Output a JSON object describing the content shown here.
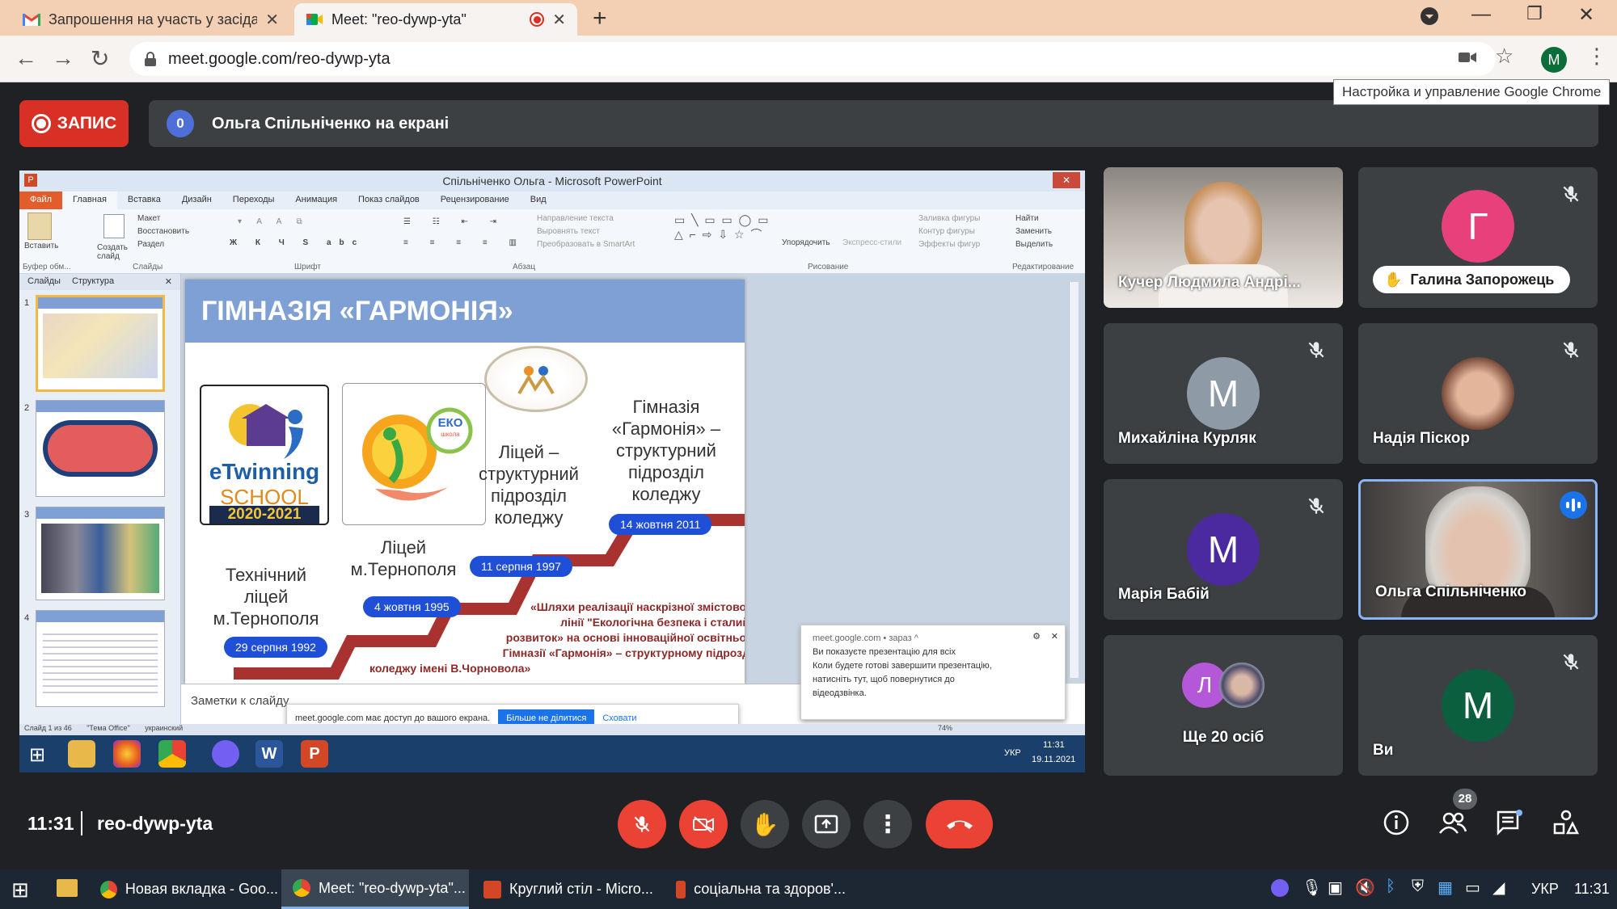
{
  "browser": {
    "tabs": [
      {
        "title": "Запрошення на участь у засіда",
        "icon": "gmail-icon",
        "active": false
      },
      {
        "title": "Meet: \"reo-dywp-yta\"",
        "icon": "meet-icon",
        "active": true
      }
    ],
    "new_tab": "+",
    "url": "meet.google.com/reo-dywp-yta",
    "profile_letter": "M",
    "tooltip": "Настройка и управление Google Chrome"
  },
  "meet": {
    "record_label": "ЗАПИС",
    "presenting_count": "0",
    "presenting_text": "Ольга Спільніченко на екрані",
    "participants": [
      {
        "name": "Кучер Людмила Андрі...",
        "avatar": "",
        "muted": false
      },
      {
        "name": "Галина Запорожець",
        "avatar": "Г",
        "muted": true,
        "color": "#e8407a"
      },
      {
        "name": "Михайліна Курляк",
        "avatar": "М",
        "muted": true,
        "color": "#8e9aa6"
      },
      {
        "name": "Надія Піскор",
        "avatar": "",
        "muted": true
      },
      {
        "name": "Марія Бабій",
        "avatar": "М",
        "muted": true,
        "color": "#4a2a9e"
      },
      {
        "name": "Ольга Спільніченко",
        "avatar": "",
        "muted": false,
        "speaking": true
      },
      {
        "name": "Ще 20 осіб",
        "avatar": "Л",
        "color": "#b457d9"
      },
      {
        "name": "Ви",
        "avatar": "М",
        "muted": true,
        "color": "#0b5e3e"
      }
    ],
    "clock": "11:31",
    "meeting_code": "reo-dywp-yta",
    "participant_count": "28"
  },
  "shared_screen": {
    "window_title": "Спільніченко Ольга - Microsoft PowerPoint",
    "ribbon_tabs": [
      "Файл",
      "Главная",
      "Вставка",
      "Дизайн",
      "Переходы",
      "Анимация",
      "Показ слайдов",
      "Рецензирование",
      "Вид"
    ],
    "ribbon_groups": [
      "Буфер обм...",
      "Слайды",
      "Шрифт",
      "Абзац",
      "Рисование",
      "Редактирование"
    ],
    "ribbon_buttons": {
      "paste": "Вставить",
      "create_slide": "Создать слайд",
      "layout": "Макет",
      "restore": "Восстановить",
      "section": "Раздел",
      "arrange": "Упорядочить",
      "express": "Экспресс-стили",
      "find": "Найти",
      "replace": "Заменить",
      "select": "Выделить",
      "fill": "Заливка фигуры",
      "outline": "Контур фигуры",
      "effects": "Эффекты фигур",
      "text_dir": "Направление текста",
      "align_text": "Выровнять текст",
      "smartart": "Преобразовать в SmartArt"
    },
    "pane_tabs": [
      "Слайды",
      "Структура"
    ],
    "slide": {
      "title": "ГІМНАЗІЯ «ГАРМОНІЯ»",
      "etwinning": {
        "line1": "eTwinning",
        "line2": "SCHOOL",
        "years": "2020-2021"
      },
      "eko": "ЕКО",
      "eko_small": "школа",
      "texts": {
        "tech_lyceum": "Технічний ліцей м.Тернополя",
        "lyceum": "Ліцей м.Тернополя",
        "lyceum_college": "Ліцей – структурний підрозділ коледжу",
        "gymnasium": "Гімназія «Гармонія» – структурний підрозділ коледжу"
      },
      "dates": [
        "29 серпня 1992",
        "4 жовтня 1995",
        "11 серпня 1997",
        "14 жовтня 2011"
      ],
      "quote_lines": [
        "«Шляхи реалізації наскрізної змістової",
        "лінії \"Екологічна безпека і сталий",
        "розвиток» на основі інноваційної освітньої",
        "Гімназії «Гармонія» – структурному підрозд",
        "коледжу імені В.Чорновола»"
      ]
    },
    "notes_placeholder": "Заметки к слайду",
    "share_bar": {
      "text": "meet.google.com має доступ до вашого екрана.",
      "stop": "Більше не ділитися",
      "hide": "Сховати"
    },
    "notification": {
      "source": "meet.google.com • зараз ^",
      "lines": [
        "Ви показуєте презентацію для всіх",
        "Коли будете готові завершити презентацію,",
        "натисніть тут, щоб повернутися до",
        "відеодзвінка."
      ]
    },
    "status": {
      "slide": "Слайд 1 из 46",
      "theme": "\"Тема Office\"",
      "lang": "украинский",
      "zoom": "74%"
    },
    "tray_lang": "УКР",
    "tray_time": "11:31",
    "tray_date": "19.11.2021"
  },
  "taskbar": {
    "apps": [
      {
        "label": "Новая вкладка - Goo...",
        "icon": "chrome-icon",
        "active": false
      },
      {
        "label": "Meet: \"reo-dywp-yta\"...",
        "icon": "chrome-icon",
        "active": true
      },
      {
        "label": "Круглий стіл - Micro...",
        "icon": "powerpoint-icon",
        "active": false
      },
      {
        "label": "соціальна та здоров'...",
        "icon": "powerpoint-icon",
        "active": false
      }
    ],
    "lang": "УКР",
    "time": "11:31"
  },
  "colors": {
    "meet_bg": "#202124",
    "tile_bg": "#3c4043",
    "red": "#ea4335",
    "blue": "#1a73e8",
    "tab_strip": "#f3cfb3"
  }
}
